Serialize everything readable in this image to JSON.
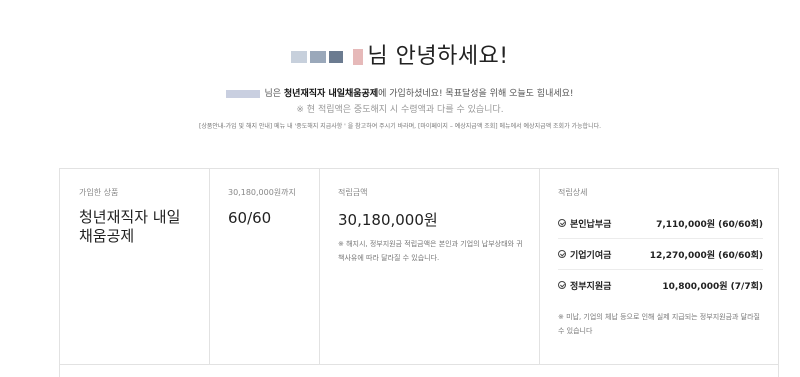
{
  "header": {
    "greeting_suffix": "님 안녕하세요!"
  },
  "intro": {
    "prefix": "님은",
    "product": "청년재직자 내일채움공제",
    "suffix": "에 가입하셨네요! 목표달성을 위해 오늘도 힘내세요!"
  },
  "warning": "※ 현 적립액은 중도해지 시 수령액과 다를 수 있습니다.",
  "guide": "[상품안내-가입 및 해지 안내] 메뉴 내 '중도해지 지급사항 ' 을 참고하여 주시기 바라며, [마이페이지 – 예상지급액 조회] 메뉴에서 예상지급액 조회가 가능합니다.",
  "summary": {
    "product_label": "가입한 상품",
    "product_name": "청년재직자 내일채움공제",
    "period_label": "30,180,000원까지",
    "period_value": "60/60",
    "saved_label": "적립금액",
    "saved_value": "30,180,000원",
    "saved_note": "※ 해지시, 정부지원금 적립금액은 본인과 기업의 납부상태와 귀책사유에 따라 달라질 수 있습니다.",
    "detail_label": "적립상세",
    "details": [
      {
        "name": "본인납부금",
        "value": "7,110,000원 (60/60회)"
      },
      {
        "name": "기업기여금",
        "value": "12,270,000원 (60/60회)"
      },
      {
        "name": "정부지원금",
        "value": "10,800,000원 (7/7회)"
      }
    ],
    "detail_note": "※ 미납, 기업의 체납 등으로 인해 실제 지급되는 정부지원금과 달라질 수 있습니다"
  }
}
